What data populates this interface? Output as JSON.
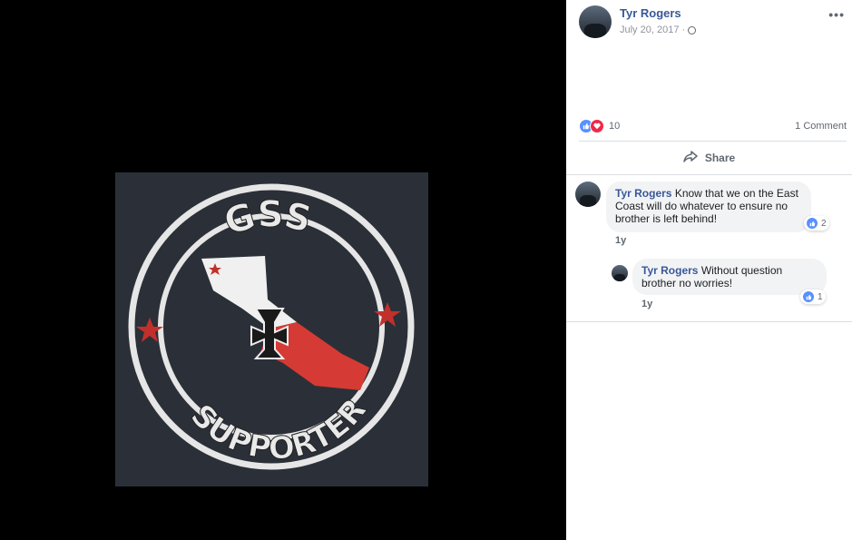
{
  "post": {
    "author": "Tyr Rogers",
    "date": "July 20, 2017",
    "separator": "·",
    "more_label": "•••",
    "reaction_count": "10",
    "comments_count": "1 Comment",
    "share_label": "Share"
  },
  "photo": {
    "logo_top_text": "GSS",
    "logo_bottom_text": "SUPPORTER"
  },
  "comments": [
    {
      "author": "Tyr Rogers",
      "text": "Know that we on the East Coast will do whatever to ensure no brother is left behind!",
      "reaction_count": "2",
      "age": "1y"
    },
    {
      "author": "Tyr Rogers",
      "text": "Without question brother no worries!",
      "reaction_count": "1",
      "age": "1y"
    }
  ],
  "colors": {
    "link": "#385898",
    "like": "#5890ff",
    "love": "#f0284a",
    "bubble": "#f2f3f5"
  }
}
